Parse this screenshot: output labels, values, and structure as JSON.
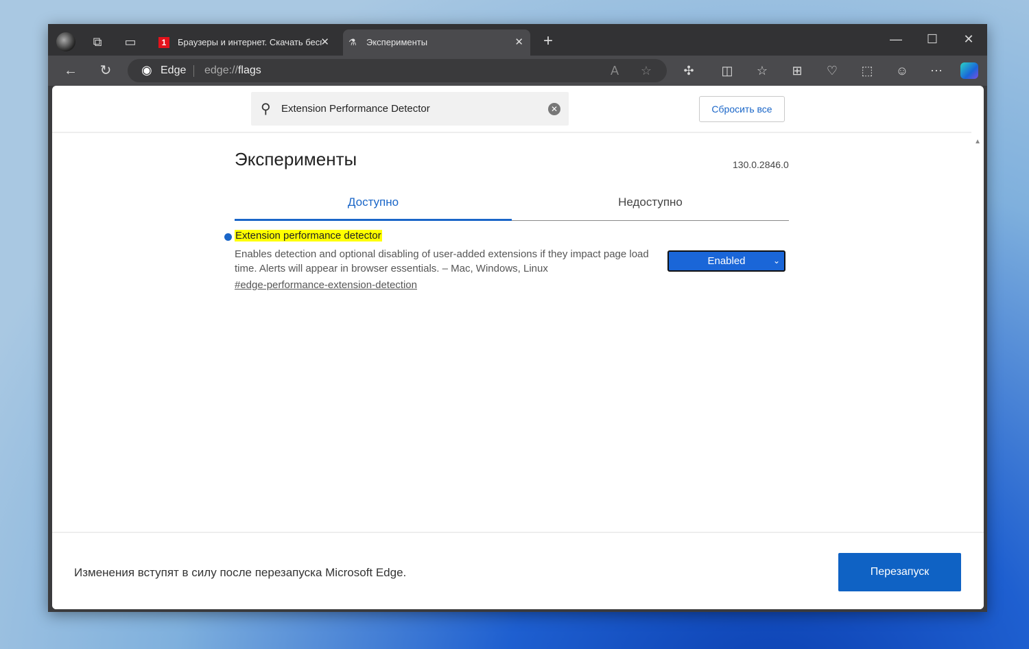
{
  "browser": {
    "tabs": [
      {
        "title": "Браузеры и интернет. Скачать бесплатно",
        "icon": "site-favicon"
      },
      {
        "title": "Эксперименты",
        "icon": "flask-icon",
        "active": true
      }
    ],
    "address": {
      "label": "Edge",
      "url_prefix": "edge://",
      "url_path": "flags"
    }
  },
  "page": {
    "search": {
      "value": "Extension Performance Detector"
    },
    "reset_label": "Сбросить все",
    "title": "Эксперименты",
    "version": "130.0.2846.0",
    "tabs": [
      {
        "label": "Доступно",
        "active": true
      },
      {
        "label": "Недоступно"
      }
    ],
    "flag": {
      "name": "Extension performance detector",
      "description": "Enables detection and optional disabling of user-added extensions if they impact page load time. Alerts will appear in browser essentials. – Mac, Windows, Linux",
      "link": "#edge-performance-extension-detection",
      "selected": "Enabled"
    },
    "footer": {
      "message": "Изменения вступят в силу после перезапуска Microsoft Edge.",
      "relaunch_label": "Перезапуск"
    }
  },
  "colors": {
    "accent": "#1a66c8",
    "highlight": "#ffff00"
  }
}
